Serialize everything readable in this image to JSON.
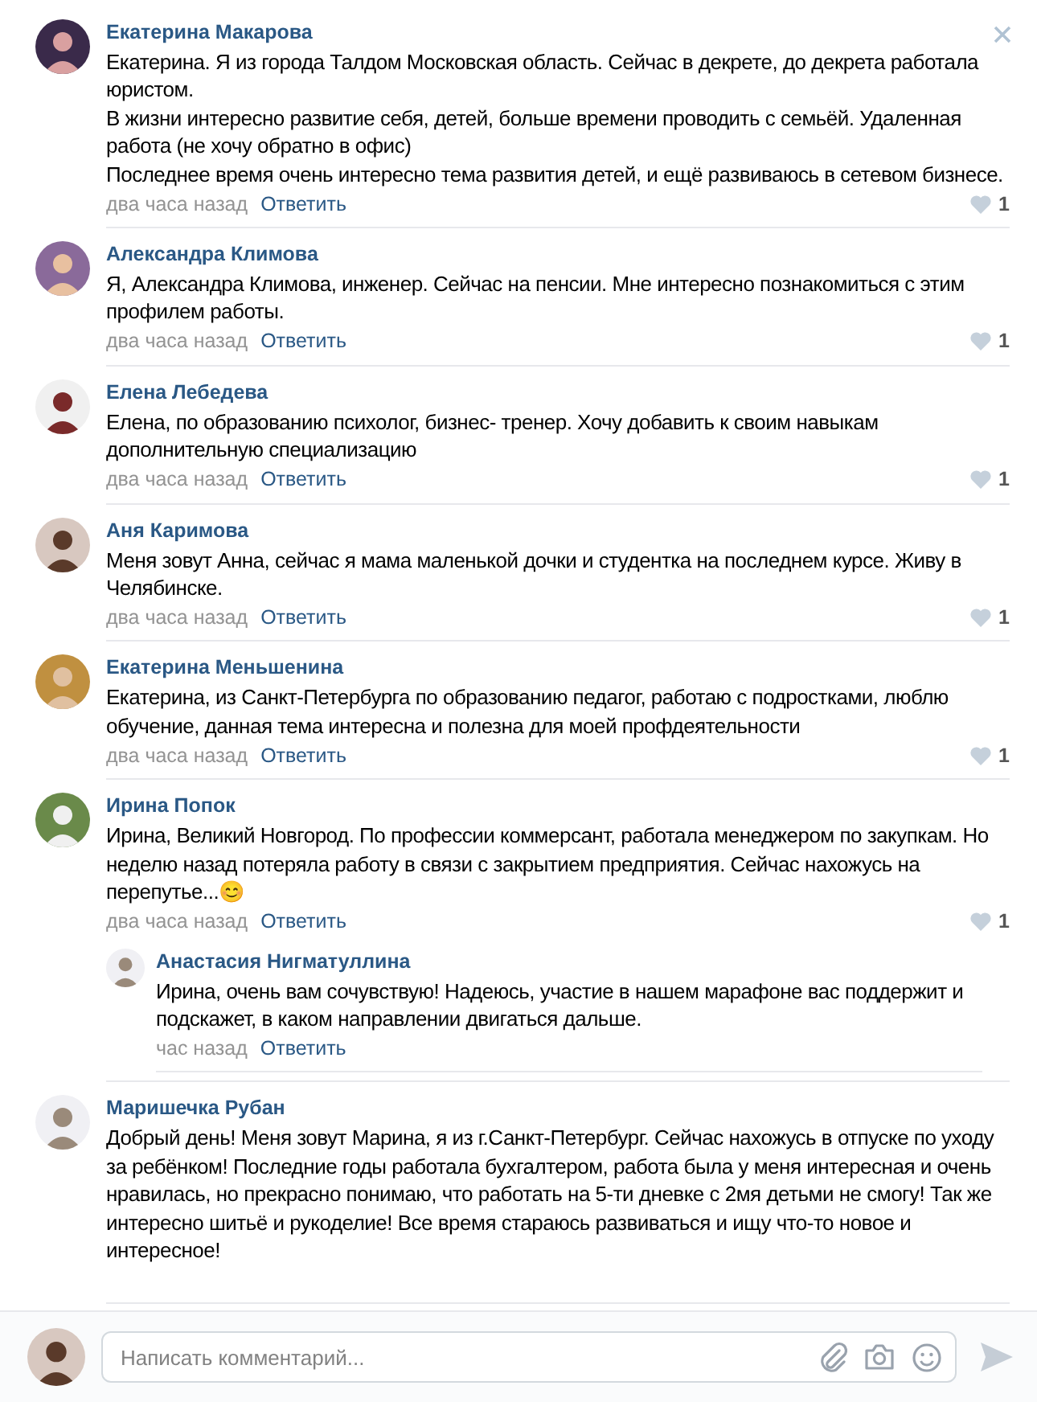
{
  "comments": [
    {
      "author": "Екатерина Макарова",
      "text": "Екатерина. Я из города Талдом Московская область. Сейчас в декрете, до декрета работала юристом.\nВ жизни интересно развитие себя, детей, больше времени проводить с семьёй. Удаленная работа (не хочу обратно в офис)\nПоследнее время очень интересно тема развития детей, и ещё развиваюсь в сетевом бизнесе.",
      "time": "два часа назад",
      "reply": "Ответить",
      "likes": "1",
      "hovered": true
    },
    {
      "author": "Александра Климова",
      "text": "Я, Александра Климова, инженер. Сейчас на пенсии. Мне интересно познакомиться с этим профилем работы.",
      "time": "два часа назад",
      "reply": "Ответить",
      "likes": "1",
      "hovered": false
    },
    {
      "author": "Елена Лебедева",
      "text": "Елена, по образованию психолог, бизнес- тренер. Хочу добавить к своим навыкам дополнительную специализацию",
      "time": "два часа назад",
      "reply": "Ответить",
      "likes": "1",
      "hovered": false
    },
    {
      "author": "Аня Каримова",
      "text": "Меня зовут Анна, сейчас я мама маленькой дочки и студентка на последнем курсе. Живу в Челябинске.",
      "time": "два часа назад",
      "reply": "Ответить",
      "likes": "1",
      "hovered": false
    },
    {
      "author": "Екатерина Меньшенина",
      "text": "Екатерина, из Санкт-Петербурга по образованию педагог, работаю с подростками, люблю обучение, данная тема интересна и полезна для моей профдеятельности",
      "time": "два часа назад",
      "reply": "Ответить",
      "likes": "1",
      "hovered": false
    },
    {
      "author": "Ирина Попок",
      "text": "Ирина, Великий Новгород. По профессии коммерсант, работала менеджером по закупкам. Но неделю назад потеряла работу в связи с закрытием предприятия. Сейчас нахожусь на перепутье...😊",
      "time": "два часа назад",
      "reply": "Ответить",
      "likes": "1",
      "hovered": false,
      "replies": [
        {
          "author": "Анастасия Нигматуллина",
          "text": "Ирина, очень вам сочувствую! Надеюсь, участие в нашем марафоне вас поддержит и подскажет, в каком направлении двигаться дальше.",
          "time": "час назад",
          "reply": "Ответить",
          "hovered": false
        }
      ]
    },
    {
      "author": "Маришечка Рубан",
      "text": "Добрый день! Меня зовут Марина, я из г.Санкт-Петербург. Сейчас нахожусь в отпуске по уходу за ребёнком! Последние годы работала бухгалтером, работа была у меня интересная и очень нравилась, но прекрасно понимаю, что работать на 5-ти дневке с 2мя детьми не смогу! Так же интересно шитьё и рукоделие! Все время стараюсь развиваться и ищу что-то новое и интересное!",
      "hovered": false
    }
  ],
  "composer": {
    "placeholder": "Написать комментарий..."
  }
}
